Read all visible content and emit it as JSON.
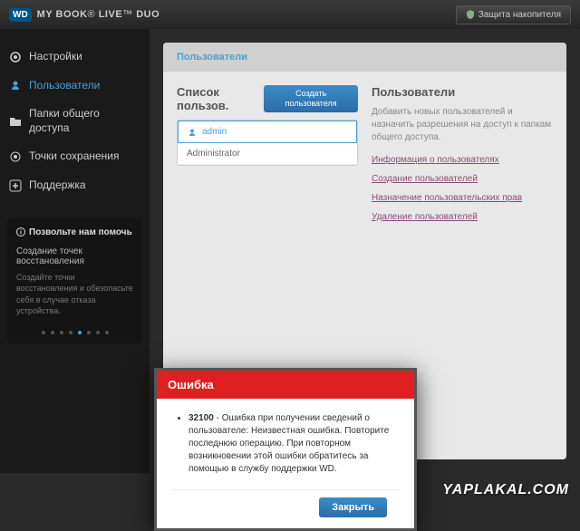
{
  "header": {
    "brand": "WD",
    "product": "MY BOOK",
    "product_suffix": "LIVE",
    "product_model": "DUO",
    "protect_label": "Защита накопителя"
  },
  "sidebar": {
    "items": [
      {
        "label": "Настройки"
      },
      {
        "label": "Пользователи"
      },
      {
        "label": "Папки общего доступа"
      },
      {
        "label": "Точки сохранения"
      },
      {
        "label": "Поддержка"
      }
    ],
    "help": {
      "title": "Позвольте нам помочь",
      "subtitle": "Создание точек восстановления",
      "desc": "Создайте точки восстановления и обезопасьте себя в случае отказа устройства."
    }
  },
  "panel": {
    "breadcrumb": "Пользователи",
    "left": {
      "title": "Список пользов.",
      "create_label": "Создать пользователя",
      "users": [
        {
          "name": "admin"
        },
        {
          "name": "Administrator"
        }
      ]
    },
    "right": {
      "title": "Пользователи",
      "desc": "Добавить новых пользователей и назначить разрешения на доступ к папкам общего доступа.",
      "links": [
        "Информация о пользователях",
        "Создание пользователей",
        "Назначение пользовательских прав",
        "Удаление пользователей"
      ]
    }
  },
  "dialog": {
    "title": "Ошибка",
    "code": "32100",
    "message": " - Ошибка при получении сведений о пользователе: Неизвестная ошибка. Повторите последнюю операцию. При повторном возникновении этой ошибки обратитесь за помощью в службу поддержки WD.",
    "close_label": "Закрыть"
  },
  "watermark": "YAPLAKAL.COM"
}
